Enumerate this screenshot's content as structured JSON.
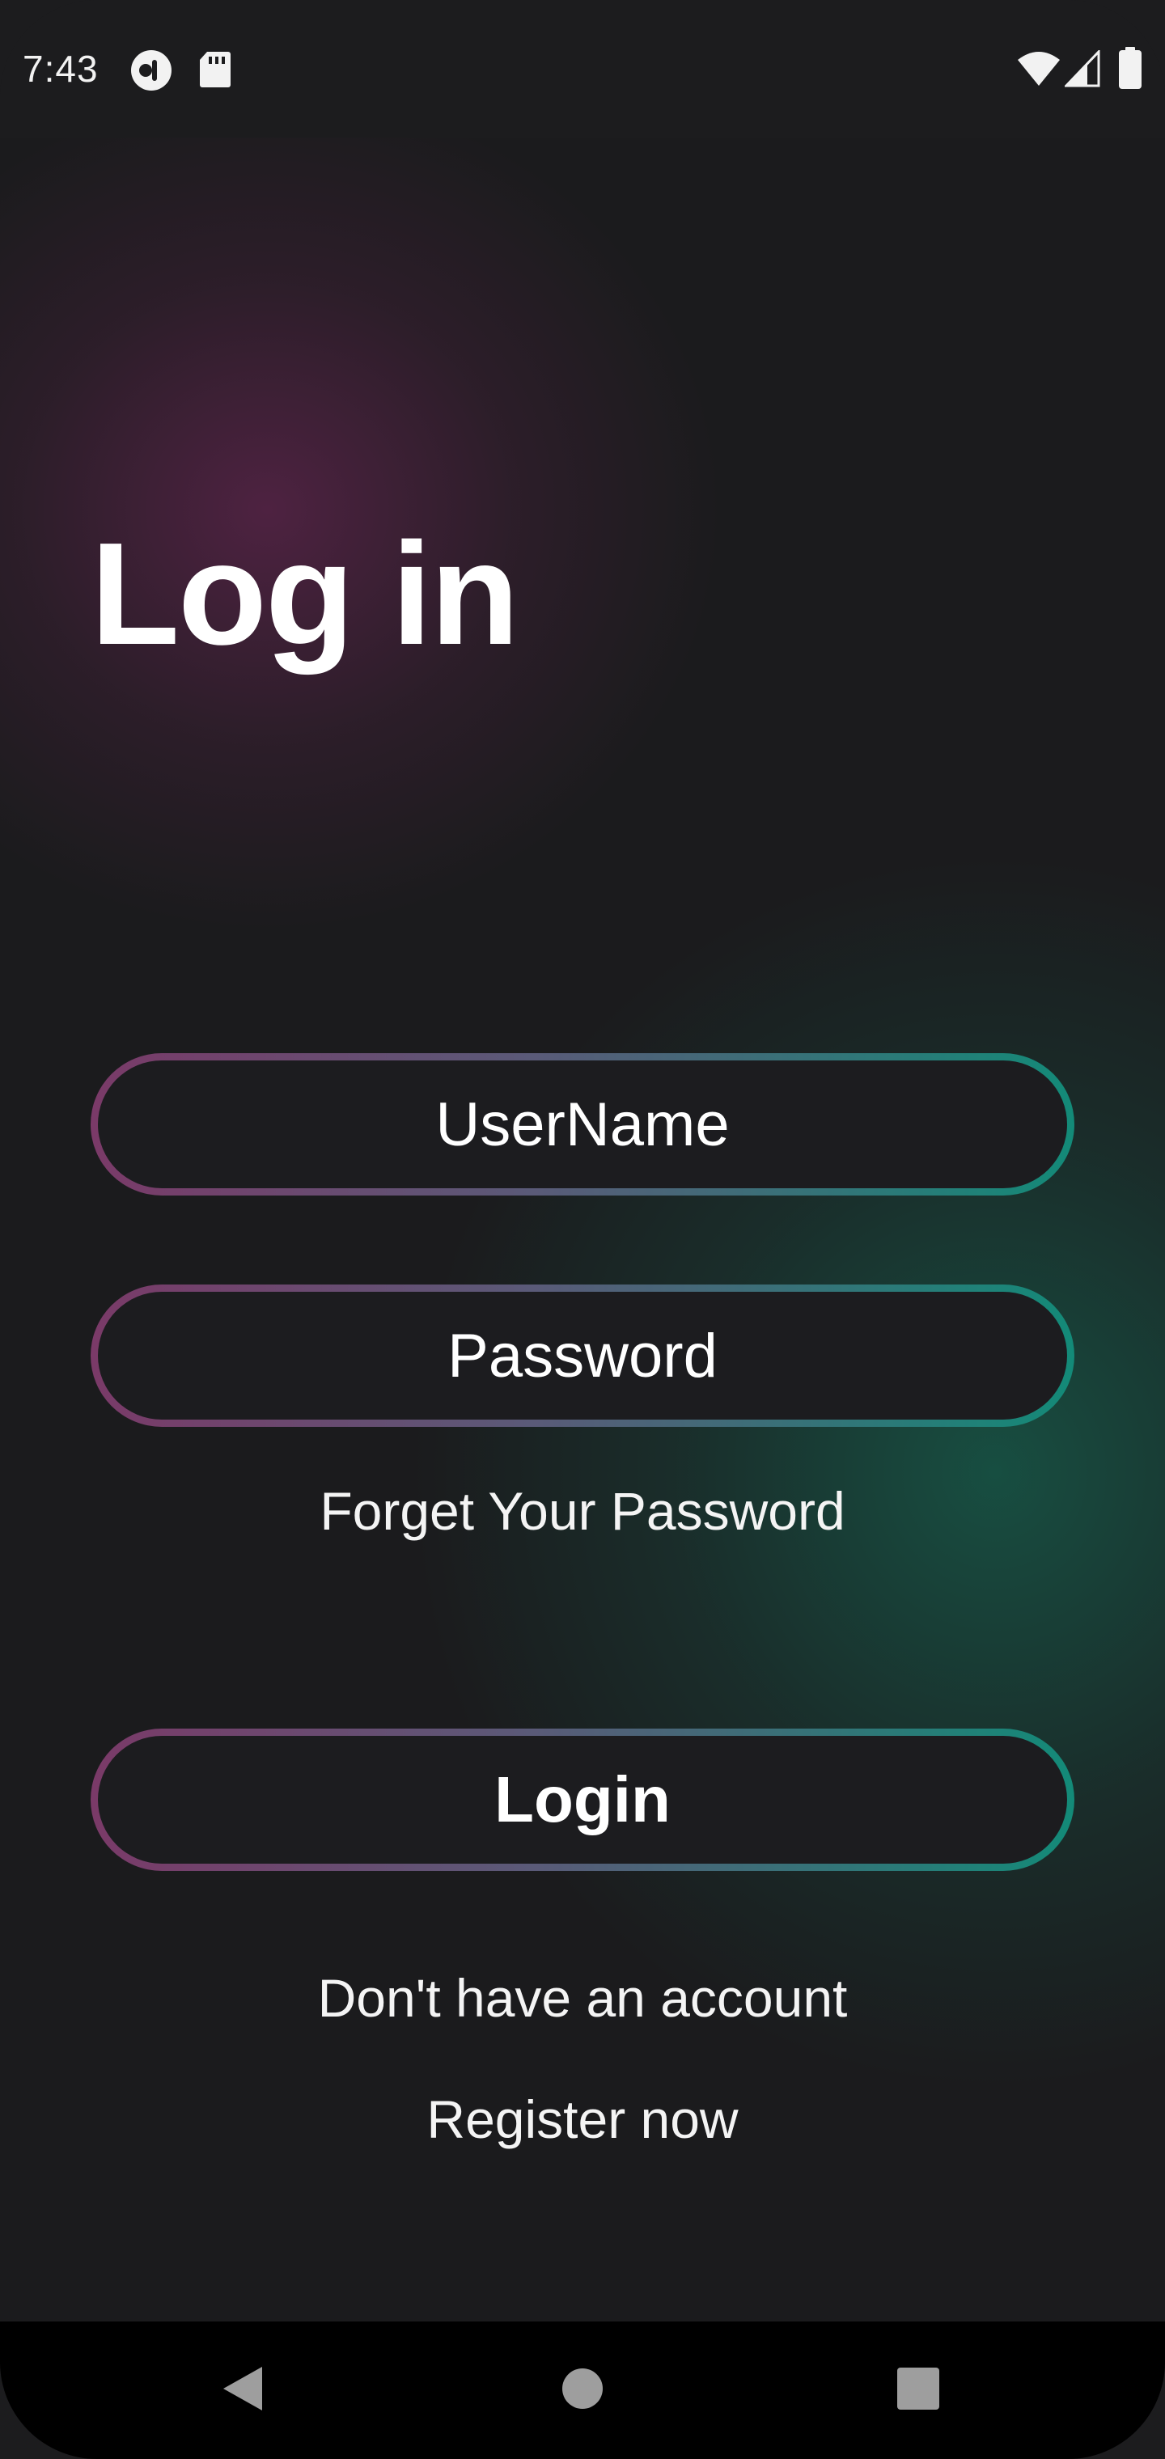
{
  "status_bar": {
    "time": "7:43",
    "left_icons": [
      "notification-app-icon",
      "sd-card-icon"
    ],
    "right_icons": [
      "wifi-icon",
      "cellular-signal-icon",
      "battery-icon"
    ]
  },
  "page": {
    "title": "Log in",
    "username_placeholder": "UserName",
    "password_placeholder": "Password",
    "forgot_password_label": "Forget Your Password",
    "login_button_label": "Login",
    "no_account_label": "Don't have an account",
    "register_label": "Register now"
  },
  "colors": {
    "background": "#1b1b1d",
    "gradient_pink": "#7a3a68",
    "gradient_teal": "#138a78",
    "text": "#ffffff"
  },
  "nav_bar": {
    "icons": [
      "back-triangle-icon",
      "home-circle-icon",
      "recents-square-icon"
    ]
  }
}
